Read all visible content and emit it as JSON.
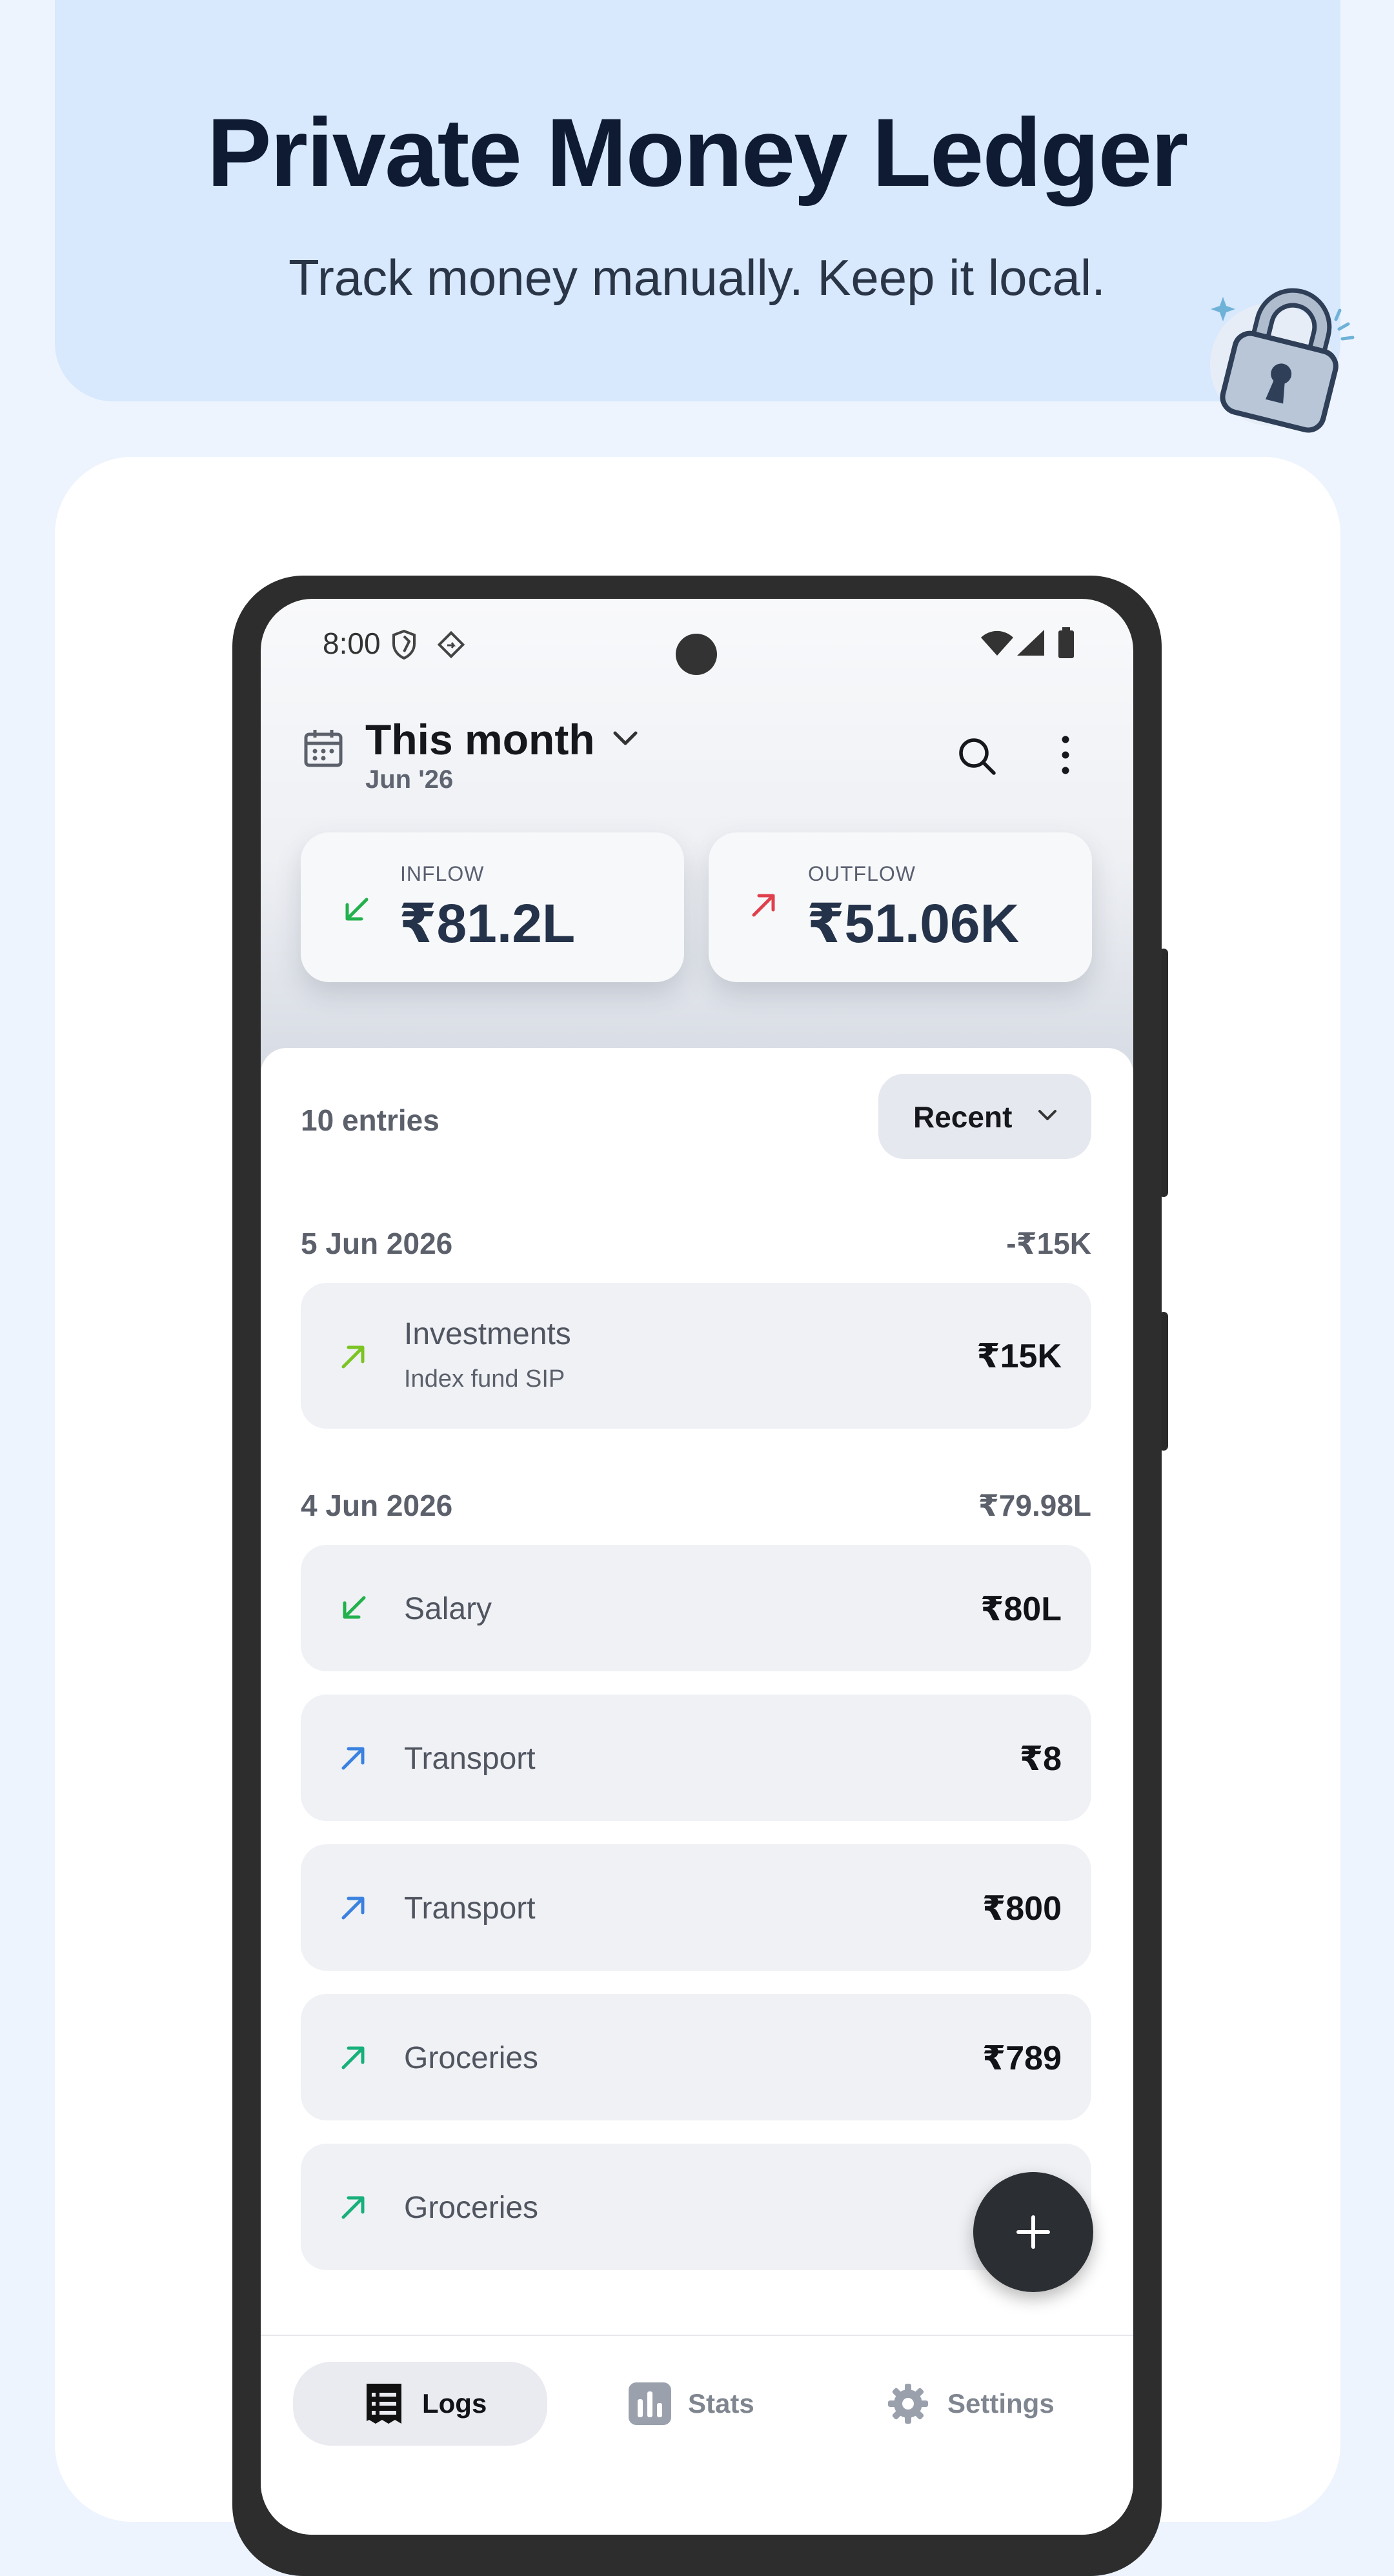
{
  "hero": {
    "title": "Private Money Ledger",
    "subtitle": "Track money manually. Keep it local.",
    "icon": "padlock-icon"
  },
  "status_bar": {
    "time": "8:00",
    "icons": [
      "shield-icon",
      "location-icon",
      "wifi-icon",
      "signal-icon",
      "battery-icon"
    ]
  },
  "header": {
    "period": "This month",
    "period_sub": "Jun '26",
    "icons": [
      "calendar-icon",
      "chevron-down-icon",
      "search-icon",
      "more-vert-icon"
    ]
  },
  "summary": {
    "inflow_label": "INFLOW",
    "inflow_value": "₹81.2L",
    "outflow_label": "OUTFLOW",
    "outflow_value": "₹51.06K"
  },
  "list": {
    "count_label": "10 entries",
    "sort_label": "Recent",
    "groups": [
      {
        "date": "5 Jun 2026",
        "total": "-₹15K",
        "items": [
          {
            "category": "Investments",
            "note": "Index fund SIP",
            "amount": "₹15K",
            "direction": "out",
            "color": "#7cc423"
          }
        ]
      },
      {
        "date": "4 Jun 2026",
        "total": "₹79.98L",
        "items": [
          {
            "category": "Salary",
            "amount": "₹80L",
            "direction": "in",
            "color": "#22b14c"
          },
          {
            "category": "Transport",
            "amount": "₹8",
            "direction": "out",
            "color": "#3b82e0"
          },
          {
            "category": "Transport",
            "amount": "₹800",
            "direction": "out",
            "color": "#3b82e0"
          },
          {
            "category": "Groceries",
            "amount": "₹789",
            "direction": "out",
            "color": "#18b07a"
          },
          {
            "category": "Groceries",
            "amount": "₹",
            "direction": "out",
            "color": "#18b07a"
          }
        ]
      }
    ]
  },
  "nav": {
    "logs": "Logs",
    "stats": "Stats",
    "settings": "Settings"
  },
  "colors": {
    "inflow": "#22b14c",
    "outflow": "#e0404b",
    "background": "#edf4fe",
    "hero": "#d8e8fd"
  }
}
